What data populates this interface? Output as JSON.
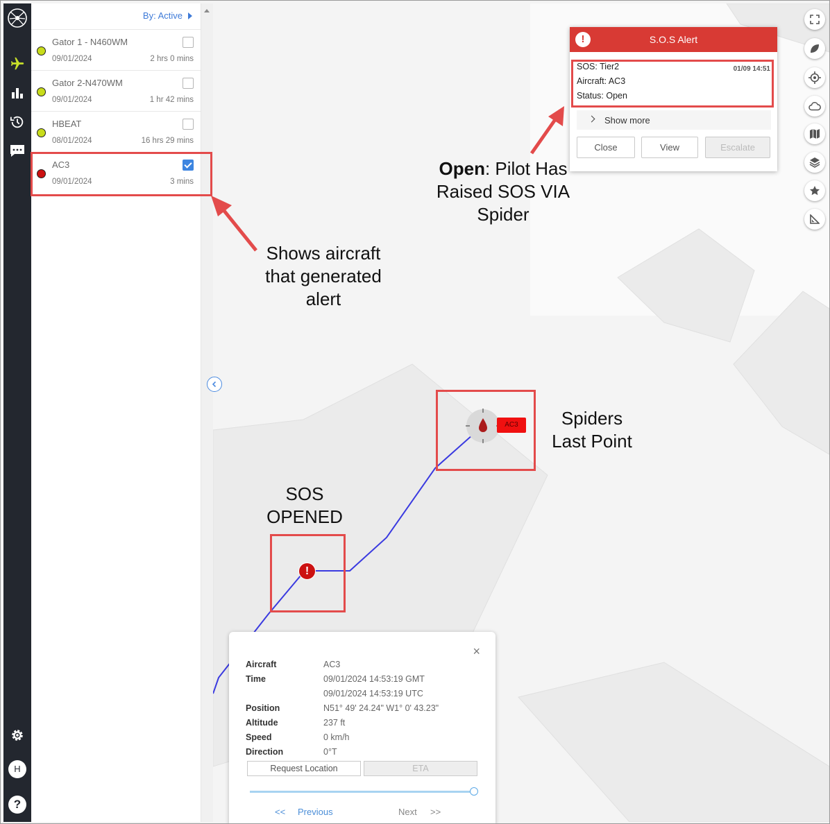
{
  "sidebar": {
    "sort_label": "By: Active",
    "aircraft": [
      {
        "name": "Gator 1 - N460WM",
        "date": "09/01/2024",
        "duration": "2 hrs 0 mins",
        "status_color": "#c8dc1a",
        "checked": false
      },
      {
        "name": "Gator 2-N470WM",
        "date": "09/01/2024",
        "duration": "1 hr 42 mins",
        "status_color": "#c8dc1a",
        "checked": false
      },
      {
        "name": "HBEAT",
        "date": "08/01/2024",
        "duration": "16 hrs 29 mins",
        "status_color": "#c8dc1a",
        "checked": false
      },
      {
        "name": "AC3",
        "date": "09/01/2024",
        "duration": "3 mins",
        "status_color": "#cc1111",
        "checked": true
      }
    ],
    "rail_icons": [
      "spider-logo-icon",
      "airplane-icon",
      "bar-chart-icon",
      "history-icon",
      "chat-icon",
      "settings-icon",
      "user-avatar",
      "help-icon"
    ],
    "avatar_letter": "H",
    "help_glyph": "?"
  },
  "map_tools": [
    "fullscreen-icon",
    "leaf-icon",
    "locate-icon",
    "weather-cloud-icon",
    "map-icon",
    "layers-icon",
    "favorites-star-icon",
    "measure-icon"
  ],
  "sos_alert": {
    "title": "S.O.S Alert",
    "icon_glyph": "!",
    "sos_line": "SOS: Tier2",
    "aircraft_line": "Aircraft: AC3",
    "status_line": "Status: Open",
    "time": "01/09 14:51",
    "show_more": "Show more",
    "buttons": {
      "close": "Close",
      "view": "View",
      "escalate": "Escalate"
    },
    "accent_color": "#d83a34"
  },
  "map": {
    "marker_label": "AC3",
    "sos_marker_glyph": "!",
    "track_color": "#3a3ae0"
  },
  "info_card": {
    "close_glyph": "×",
    "rows": [
      {
        "key": "Aircraft",
        "value": "AC3"
      },
      {
        "key": "Time",
        "value": "09/01/2024 14:53:19 GMT"
      },
      {
        "key": "",
        "value": "09/01/2024 14:53:19 UTC"
      },
      {
        "key": "Position",
        "value": "N51° 49' 24.24\" W1° 0' 43.23\""
      },
      {
        "key": "Altitude",
        "value": "237 ft"
      },
      {
        "key": "Speed",
        "value": "0 km/h"
      },
      {
        "key": "Direction",
        "value": "0°T"
      }
    ],
    "request_location": "Request Location",
    "eta": "ETA",
    "playback_position": 1.0,
    "prev_arrows": "<<",
    "previous": "Previous",
    "next": "Next",
    "next_arrows": ">>"
  },
  "annotations": {
    "open_bold": "Open",
    "open_rest": ": Pilot Has",
    "open_line2": "Raised SOS VIA",
    "open_line3": "Spider",
    "shows_aircraft": [
      "Shows aircraft",
      "that generated",
      "alert"
    ],
    "spiders_last_point": [
      "Spiders",
      "Last Point"
    ],
    "sos_opened": [
      "SOS",
      "OPENED"
    ],
    "highlight_color": "#e34b4b"
  }
}
